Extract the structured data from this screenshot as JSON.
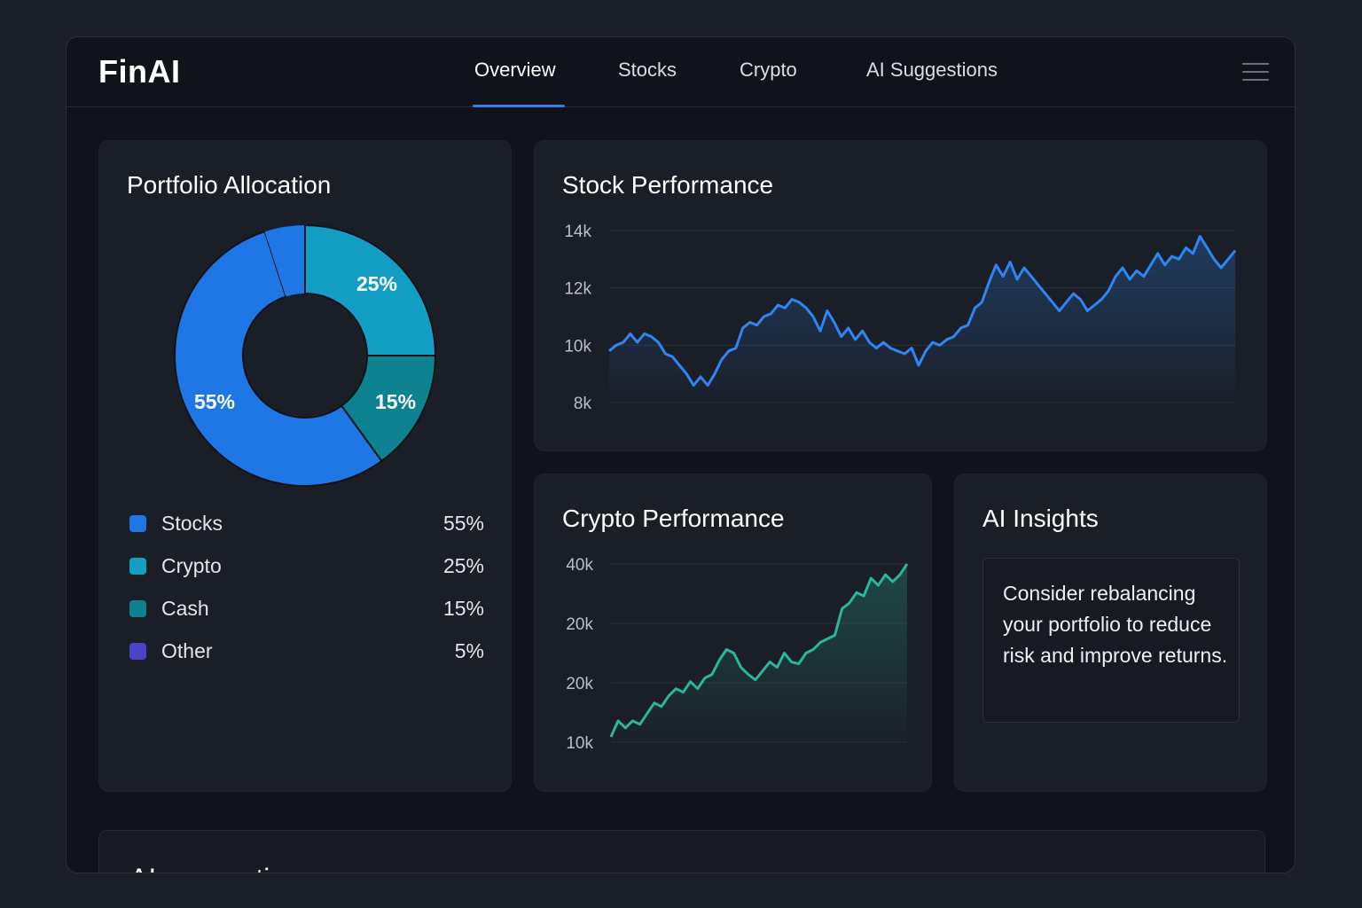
{
  "app": {
    "name": "FinAI"
  },
  "nav": {
    "tabs": [
      {
        "label": "Overview",
        "active": true
      },
      {
        "label": "Stocks",
        "active": false
      },
      {
        "label": "Crypto",
        "active": false
      },
      {
        "label": "AI Suggestions",
        "active": false
      }
    ]
  },
  "icons": {
    "menu": "hamburger-menu-icon"
  },
  "colors": {
    "stocks": "#1f76e5",
    "crypto": "#139fc4",
    "cash": "#0f8291",
    "other": "#4b43c9",
    "stock_line": "#2f86f2",
    "crypto_line": "#2bb59c",
    "accent": "#2f7fe8"
  },
  "portfolio": {
    "title": "Portfolio Allocation",
    "legend": [
      {
        "label": "Stocks",
        "value": "55%",
        "color": "#1f76e5"
      },
      {
        "label": "Crypto",
        "value": "25%",
        "color": "#139fc4"
      },
      {
        "label": "Cash",
        "value": "15%",
        "color": "#0f8291"
      },
      {
        "label": "Other",
        "value": "5%",
        "color": "#4b43c9"
      }
    ]
  },
  "stock_perf": {
    "title": "Stock Performance"
  },
  "crypto_perf": {
    "title": "Crypto Performance"
  },
  "insights": {
    "title": "AI Insights",
    "text": "Consider rebalancing your portfolio to reduce risk and improve returns."
  },
  "suggestions": {
    "title": "AI suggestions"
  },
  "chart_data": [
    {
      "type": "pie",
      "donut": true,
      "slices": [
        {
          "label": "Stocks",
          "value": 55,
          "text": "55%"
        },
        {
          "label": "Crypto",
          "value": 25,
          "text": "25%"
        },
        {
          "label": "Cash",
          "value": 15,
          "text": "15%"
        },
        {
          "label": "Other",
          "value": 5,
          "text": ""
        }
      ]
    },
    {
      "type": "area",
      "ylim": [
        8000,
        14000
      ],
      "yticks": [
        {
          "value": 14000,
          "label": "14k"
        },
        {
          "value": 12000,
          "label": "12k"
        },
        {
          "value": 10000,
          "label": "10k"
        },
        {
          "value": 8000,
          "label": "8k"
        }
      ],
      "grid": true,
      "values": [
        9800,
        10000,
        10100,
        10400,
        10100,
        10400,
        10300,
        10100,
        9700,
        9600,
        9300,
        9000,
        8600,
        8900,
        8600,
        9000,
        9500,
        9800,
        9900,
        10600,
        10800,
        10700,
        11000,
        11100,
        11400,
        11300,
        11600,
        11500,
        11300,
        11000,
        10500,
        11200,
        10800,
        10300,
        10600,
        10200,
        10500,
        10100,
        9900,
        10100,
        9900,
        9800,
        9700,
        9900,
        9300,
        9800,
        10100,
        10000,
        10200,
        10300,
        10600,
        10700,
        11300,
        11500,
        12200,
        12800,
        12400,
        12900,
        12300,
        12700,
        12400,
        12100,
        11800,
        11500,
        11200,
        11500,
        11800,
        11600,
        11200,
        11400,
        11600,
        11900,
        12400,
        12700,
        12300,
        12600,
        12400,
        12800,
        13200,
        12800,
        13100,
        13000,
        13400,
        13200,
        13800,
        13400,
        13000,
        12700,
        13000,
        13300
      ]
    },
    {
      "type": "area",
      "yticks": [
        {
          "label": "40k"
        },
        {
          "label": "20k"
        },
        {
          "label": "20k"
        },
        {
          "label": "10k"
        }
      ],
      "grid": true,
      "values": [
        0.03,
        0.12,
        0.08,
        0.12,
        0.1,
        0.16,
        0.22,
        0.2,
        0.26,
        0.3,
        0.28,
        0.34,
        0.3,
        0.36,
        0.38,
        0.46,
        0.52,
        0.5,
        0.42,
        0.38,
        0.35,
        0.4,
        0.45,
        0.42,
        0.5,
        0.45,
        0.44,
        0.5,
        0.52,
        0.56,
        0.58,
        0.6,
        0.75,
        0.78,
        0.84,
        0.82,
        0.92,
        0.88,
        0.94,
        0.9,
        0.94,
        1.0
      ]
    }
  ]
}
